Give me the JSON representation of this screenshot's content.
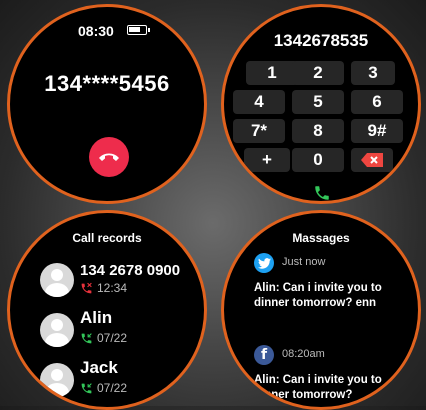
{
  "status": {
    "time": "08:30"
  },
  "call": {
    "number": "134****5456"
  },
  "dialer": {
    "number": "1342678535",
    "keys": [
      "1",
      "2",
      "3",
      "4",
      "5",
      "6",
      "7*",
      "8",
      "9#",
      "+",
      "0"
    ]
  },
  "call_records": {
    "title": "Call records",
    "items": [
      {
        "name": "134 2678 0900",
        "time": "12:34",
        "type": "missed"
      },
      {
        "name": "Alin",
        "time": "07/22",
        "type": "incoming"
      },
      {
        "name": "Jack",
        "time": "07/22",
        "type": "incoming"
      }
    ]
  },
  "messages": {
    "title": "Massages",
    "items": [
      {
        "app": "twitter",
        "time": "Just now",
        "text": "Alin: Can i invite you to dinner tomorrow? enn"
      },
      {
        "app": "facebook",
        "time": "08:20am",
        "text": "Alin: Can i invite you to dinner tomorrow?"
      }
    ]
  },
  "colors": {
    "ring": "#e0621e",
    "hangup": "#ee2c4c",
    "call_green": "#33c75a",
    "missed_red": "#e8323c",
    "delete": "#ef4640"
  }
}
